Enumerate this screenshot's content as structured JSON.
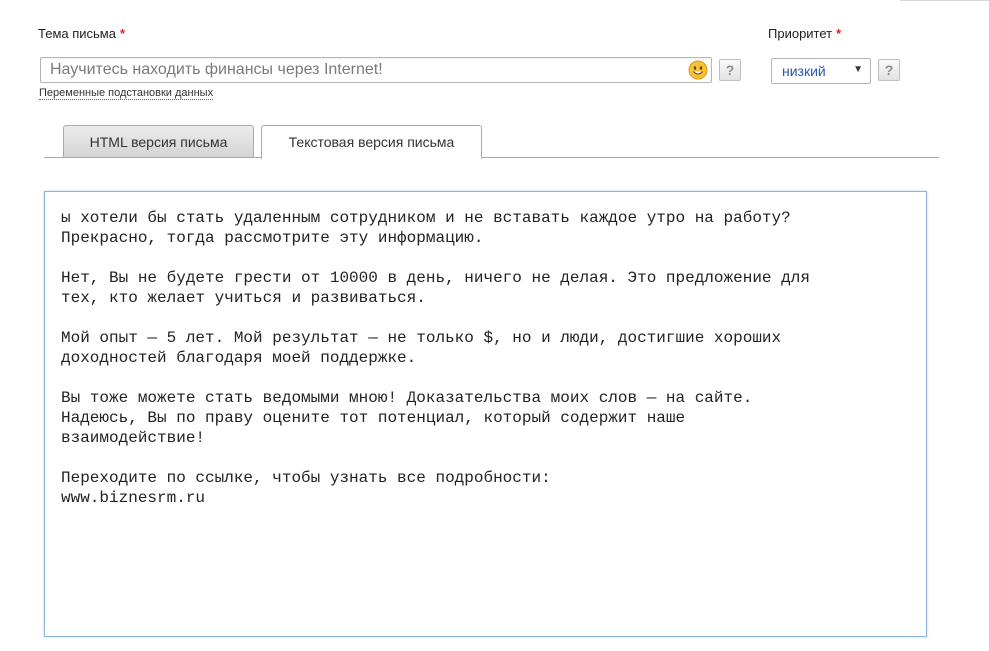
{
  "subject": {
    "label": "Тема письма",
    "required_mark": "*",
    "value": "Научитесь находить финансы через Internet!",
    "help": "?",
    "substitutions_link": "Переменные подстановки данных"
  },
  "priority": {
    "label": "Приоритет",
    "required_mark": "*",
    "selected": "низкий",
    "arrow": "▼",
    "help": "?"
  },
  "tabs": [
    {
      "label": "HTML версия письма",
      "active": false
    },
    {
      "label": "Текстовая версия письма",
      "active": true
    }
  ],
  "editor": {
    "lines": [
      "ы хотели бы стать удаленным сотрудником и не вставать каждое утро на работу?",
      "Прекрасно, тогда рассмотрите эту информацию.",
      "",
      "Нет, Вы не будете грести от 10000 в день, ничего не делая. Это предложение для",
      "тех, кто желает учиться и развиваться.",
      "",
      "Мой опыт — 5 лет. Мой результат — не только $, но и люди, достигшие хороших",
      "доходностей благодаря моей поддержке.",
      "",
      "Вы тоже можете стать ведомыми мною! Доказательства моих слов — на сайте.",
      "Надеюсь, Вы по праву оцените тот потенциал, который содержит наше",
      "взаимодействие!",
      "",
      "Переходите по ссылке, чтобы узнать все подробности:",
      "www.biznesrm.ru"
    ]
  },
  "colors": {
    "required": "#d9261c",
    "select_text": "#2a56a8",
    "editor_border": "#8fb6d8"
  },
  "icons": {
    "emoji": "smiley-icon"
  }
}
